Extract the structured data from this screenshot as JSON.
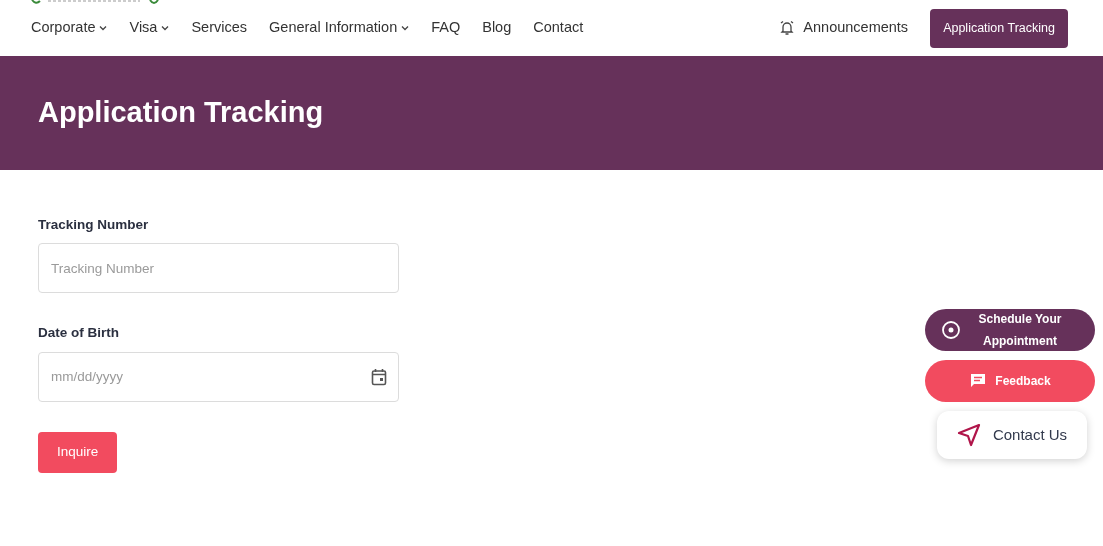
{
  "nav": {
    "items": [
      {
        "label": "Corporate",
        "has_menu": true
      },
      {
        "label": "Visa",
        "has_menu": true
      },
      {
        "label": "Services",
        "has_menu": false
      },
      {
        "label": "General Information",
        "has_menu": true
      },
      {
        "label": "FAQ",
        "has_menu": false
      },
      {
        "label": "Blog",
        "has_menu": false
      },
      {
        "label": "Contact",
        "has_menu": false
      }
    ],
    "announcements": "Announcements",
    "tracking_button": "Application Tracking"
  },
  "banner": {
    "title": "Application Tracking"
  },
  "form": {
    "fields": [
      {
        "kind": "text",
        "label": "Tracking Number",
        "placeholder": "Tracking Number"
      },
      {
        "kind": "date",
        "label": "Date of Birth",
        "placeholder": "mm/dd/yyyy"
      }
    ],
    "submit": "Inquire"
  },
  "floating": [
    {
      "kind": "schedule",
      "lines": [
        "Schedule Your",
        "Appointment"
      ]
    },
    {
      "kind": "feedback",
      "lines": [
        "Feedback"
      ]
    },
    {
      "kind": "contact",
      "lines": [
        "Contact Us"
      ]
    }
  ]
}
